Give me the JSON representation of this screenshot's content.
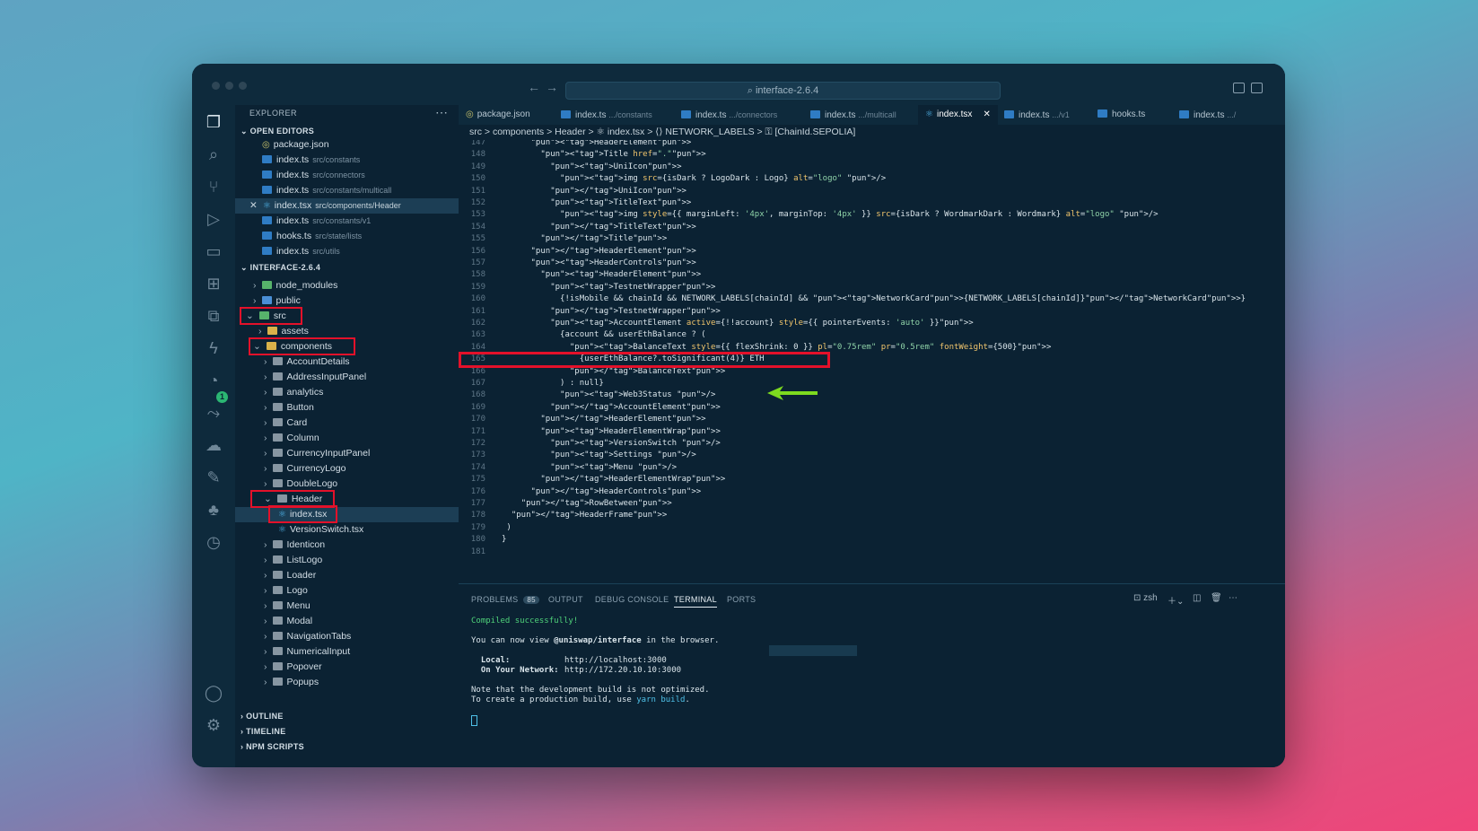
{
  "window": {
    "search": "interface-2.6.4"
  },
  "explorer": {
    "title": "EXPLORER",
    "open_editors_label": "OPEN EDITORS",
    "open_editors": [
      {
        "name": "package.json",
        "path": "",
        "type": "json"
      },
      {
        "name": "index.ts",
        "path": "src/constants",
        "type": "ts"
      },
      {
        "name": "index.ts",
        "path": "src/connectors",
        "type": "ts"
      },
      {
        "name": "index.ts",
        "path": "src/constants/multicall",
        "type": "ts"
      },
      {
        "name": "index.tsx",
        "path": "src/components/Header",
        "type": "tsx"
      },
      {
        "name": "index.ts",
        "path": "src/constants/v1",
        "type": "ts"
      },
      {
        "name": "hooks.ts",
        "path": "src/state/lists",
        "type": "ts"
      },
      {
        "name": "index.ts",
        "path": "src/utils",
        "type": "ts"
      }
    ],
    "project_label": "INTERFACE-2.6.4",
    "tree": [
      {
        "name": "node_modules"
      },
      {
        "name": "public"
      },
      {
        "name": "src"
      },
      {
        "name": "assets"
      },
      {
        "name": "components"
      },
      {
        "name": "AccountDetails"
      },
      {
        "name": "AddressInputPanel"
      },
      {
        "name": "analytics"
      },
      {
        "name": "Button"
      },
      {
        "name": "Card"
      },
      {
        "name": "Column"
      },
      {
        "name": "CurrencyInputPanel"
      },
      {
        "name": "CurrencyLogo"
      },
      {
        "name": "DoubleLogo"
      },
      {
        "name": "Header"
      },
      {
        "name": "index.tsx"
      },
      {
        "name": "VersionSwitch.tsx"
      },
      {
        "name": "Identicon"
      },
      {
        "name": "ListLogo"
      },
      {
        "name": "Loader"
      },
      {
        "name": "Logo"
      },
      {
        "name": "Menu"
      },
      {
        "name": "Modal"
      },
      {
        "name": "NavigationTabs"
      },
      {
        "name": "NumericalInput"
      },
      {
        "name": "Popover"
      },
      {
        "name": "Popups"
      }
    ],
    "outline_label": "OUTLINE",
    "timeline_label": "TIMELINE",
    "npm_label": "NPM SCRIPTS",
    "badge": "1"
  },
  "tabs": [
    {
      "name": "package.json",
      "dim": ""
    },
    {
      "name": "index.ts",
      "dim": ".../constants"
    },
    {
      "name": "index.ts",
      "dim": ".../connectors"
    },
    {
      "name": "index.ts",
      "dim": ".../multicall"
    },
    {
      "name": "index.tsx",
      "dim": ""
    },
    {
      "name": "index.ts",
      "dim": ".../v1"
    },
    {
      "name": "hooks.ts",
      "dim": ""
    },
    {
      "name": "index.ts",
      "dim": ".../"
    }
  ],
  "breadcrumb": "src > components > Header > ⚛ index.tsx > ⟨⟩ NETWORK_LABELS > ⚿ [ChainId.SEPOLIA]",
  "code_lines": [
    {
      "n": "147",
      "t": "      <HeaderElement>"
    },
    {
      "n": "148",
      "t": "        <Title href=\".\">"
    },
    {
      "n": "149",
      "t": "          <UniIcon>"
    },
    {
      "n": "150",
      "t": "            <img src={isDark ? LogoDark : Logo} alt=\"logo\" />"
    },
    {
      "n": "151",
      "t": "          </UniIcon>"
    },
    {
      "n": "152",
      "t": "          <TitleText>"
    },
    {
      "n": "153",
      "t": "            <img style={{ marginLeft: '4px', marginTop: '4px' }} src={isDark ? WordmarkDark : Wordmark} alt=\"logo\" />"
    },
    {
      "n": "154",
      "t": "          </TitleText>"
    },
    {
      "n": "155",
      "t": "        </Title>"
    },
    {
      "n": "156",
      "t": "      </HeaderElement>"
    },
    {
      "n": "157",
      "t": "      <HeaderControls>"
    },
    {
      "n": "158",
      "t": "        <HeaderElement>"
    },
    {
      "n": "159",
      "t": "          <TestnetWrapper>"
    },
    {
      "n": "160",
      "t": "            {!isMobile && chainId && NETWORK_LABELS[chainId] && <NetworkCard>{NETWORK_LABELS[chainId]}</NetworkCard>}"
    },
    {
      "n": "161",
      "t": "          </TestnetWrapper>"
    },
    {
      "n": "162",
      "t": "          <AccountElement active={!!account} style={{ pointerEvents: 'auto' }}>"
    },
    {
      "n": "163",
      "t": "            {account && userEthBalance ? ("
    },
    {
      "n": "164",
      "t": "              <BalanceText style={{ flexShrink: 0 }} pl=\"0.75rem\" pr=\"0.5rem\" fontWeight={500}>"
    },
    {
      "n": "165",
      "t": "                {userEthBalance?.toSignificant(4)} ETH"
    },
    {
      "n": "166",
      "t": "              </BalanceText>"
    },
    {
      "n": "167",
      "t": "            ) : null}"
    },
    {
      "n": "168",
      "t": "            <Web3Status />"
    },
    {
      "n": "169",
      "t": "          </AccountElement>"
    },
    {
      "n": "170",
      "t": "        </HeaderElement>"
    },
    {
      "n": "171",
      "t": "        <HeaderElementWrap>"
    },
    {
      "n": "172",
      "t": "          <VersionSwitch />"
    },
    {
      "n": "173",
      "t": "          <Settings />"
    },
    {
      "n": "174",
      "t": "          <Menu />"
    },
    {
      "n": "175",
      "t": "        </HeaderElementWrap>"
    },
    {
      "n": "176",
      "t": "      </HeaderControls>"
    },
    {
      "n": "177",
      "t": "    </RowBetween>"
    },
    {
      "n": "178",
      "t": "  </HeaderFrame>"
    },
    {
      "n": "179",
      "t": " )"
    },
    {
      "n": "180",
      "t": "}"
    },
    {
      "n": "181",
      "t": ""
    }
  ],
  "panel": {
    "tabs": [
      {
        "label": "PROBLEMS",
        "count": "85"
      },
      {
        "label": "OUTPUT",
        "count": ""
      },
      {
        "label": "DEBUG CONSOLE",
        "count": ""
      },
      {
        "label": "TERMINAL",
        "count": ""
      },
      {
        "label": "PORTS",
        "count": ""
      }
    ],
    "shell": "zsh",
    "terminal": {
      "compiled": "Compiled successfully!",
      "view_prefix": "You can now view ",
      "view_app": "@uniswap/interface",
      "view_suffix": " in the browser.",
      "local_label": "  Local:",
      "local_url": "http://localhost:3000",
      "network_label": "  On Your Network:",
      "network_url": "http://172.20.10.10:3000",
      "note1": "Note that the development build is not optimized.",
      "note2_prefix": "To create a production build, use ",
      "note2_cmd": "yarn build",
      "note2_suffix": "."
    }
  }
}
